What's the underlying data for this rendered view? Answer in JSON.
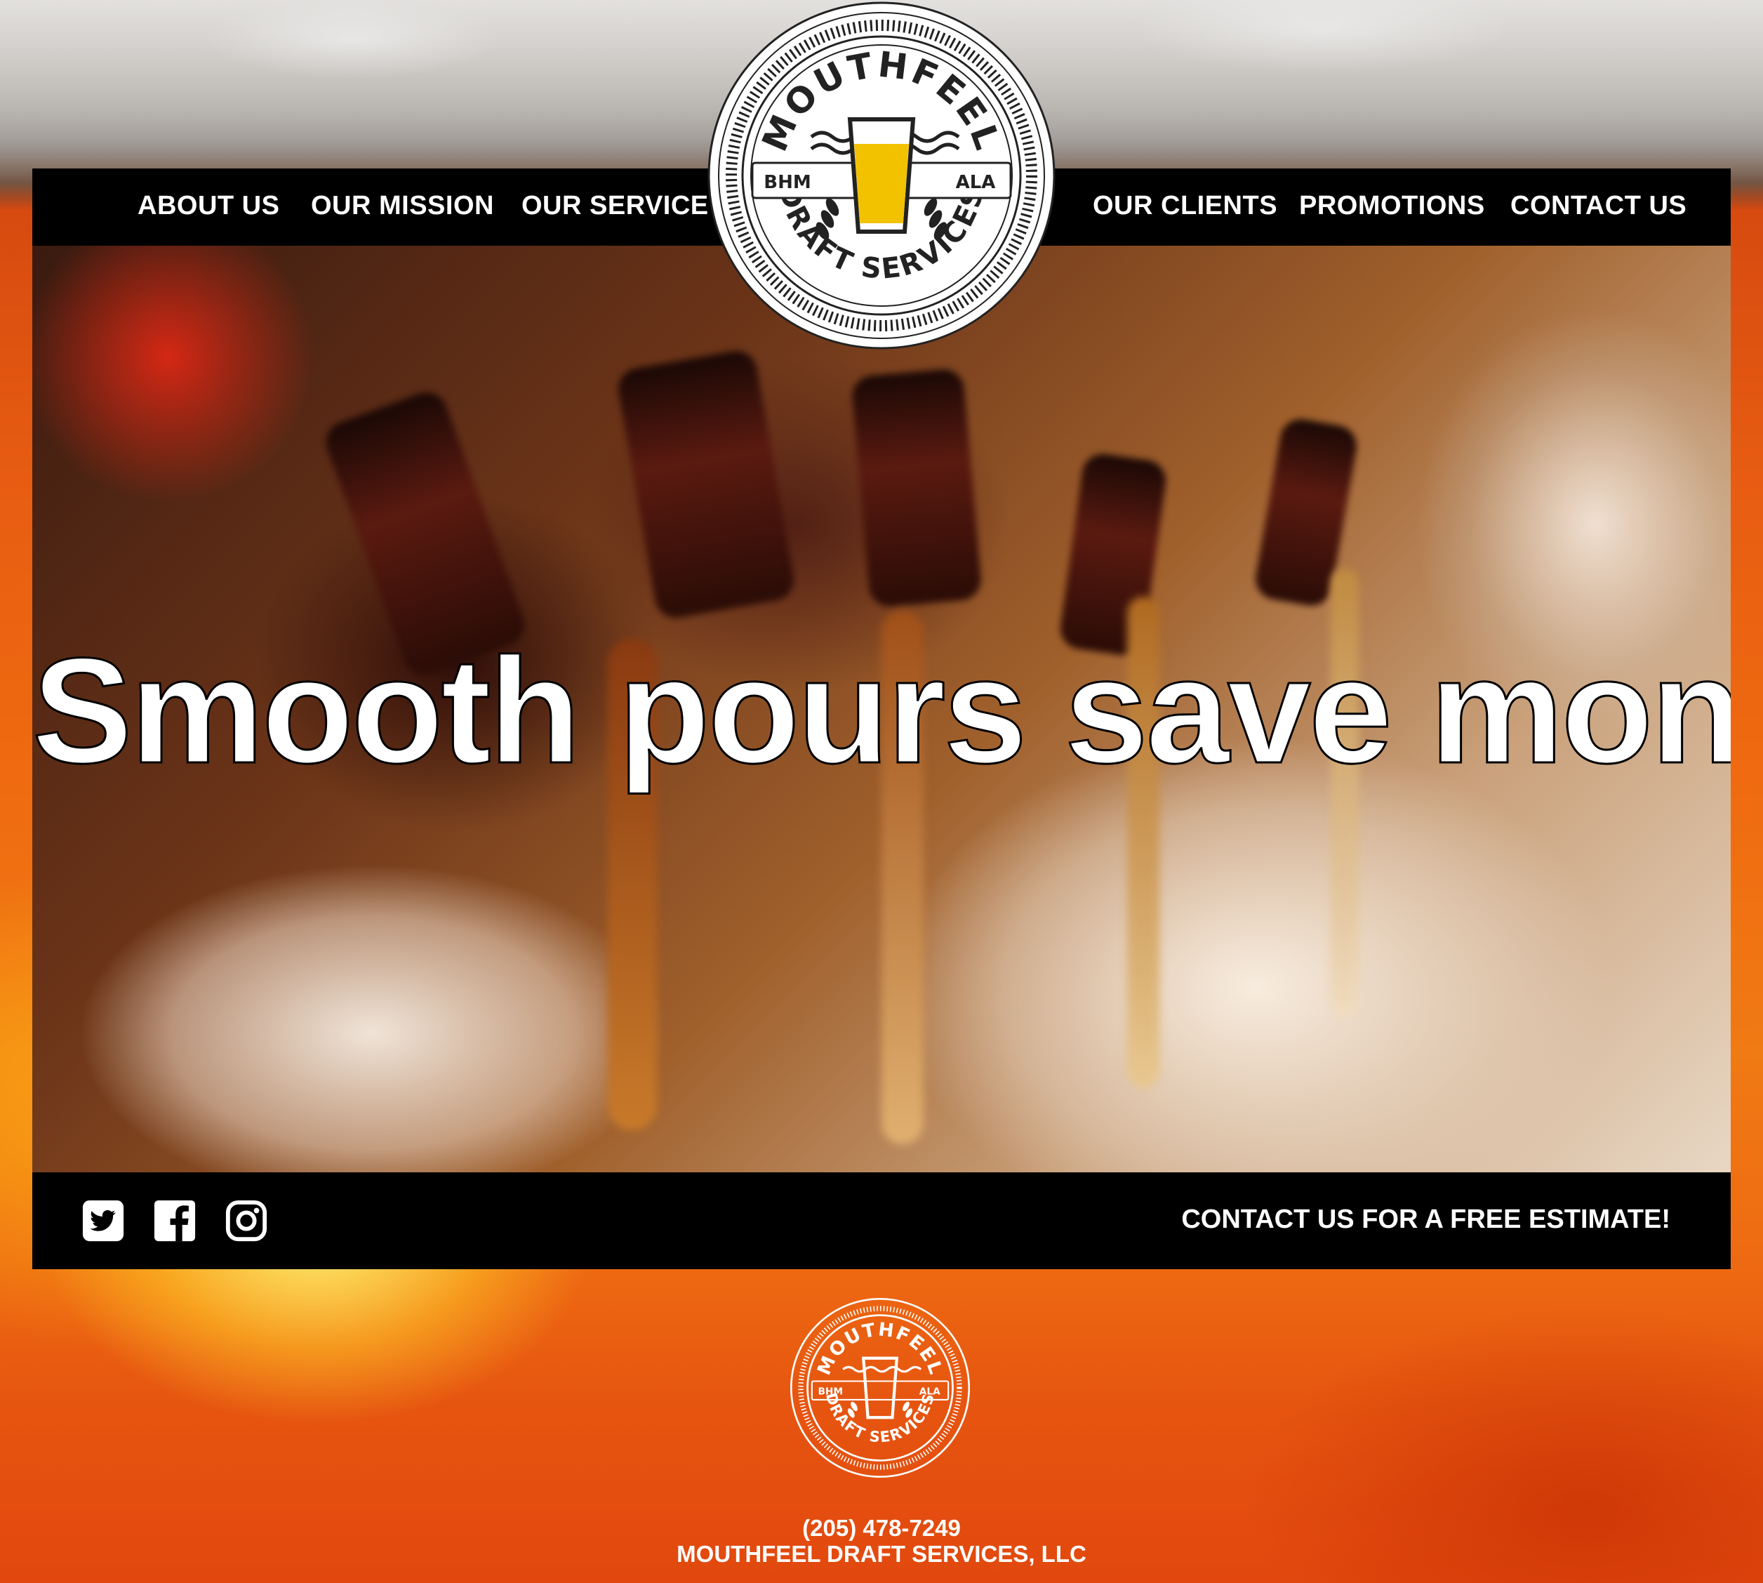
{
  "brand": {
    "name_arc_top": "MOUTHFEEL",
    "name_arc_bottom": "DRAFT SERVICES",
    "left_badge": "BHM",
    "right_badge": "ALA",
    "beer_color": "#f2c200",
    "accent_orange": "#f07a14"
  },
  "nav": {
    "left_items": [
      {
        "label": "ABOUT US"
      },
      {
        "label": "OUR MISSION"
      },
      {
        "label": "OUR SERVICE"
      }
    ],
    "right_items": [
      {
        "label": "OUR CLIENTS"
      },
      {
        "label": "PROMOTIONS"
      },
      {
        "label": "CONTACT US"
      }
    ]
  },
  "hero": {
    "headline": "Smooth pours save money."
  },
  "bottom_bar": {
    "social_icons": [
      "twitter-icon",
      "facebook-icon",
      "instagram-icon"
    ],
    "cta": "CONTACT US FOR A FREE ESTIMATE!"
  },
  "footer": {
    "phone": "(205) 478-7249",
    "company": "MOUTHFEEL DRAFT SERVICES, LLC"
  }
}
